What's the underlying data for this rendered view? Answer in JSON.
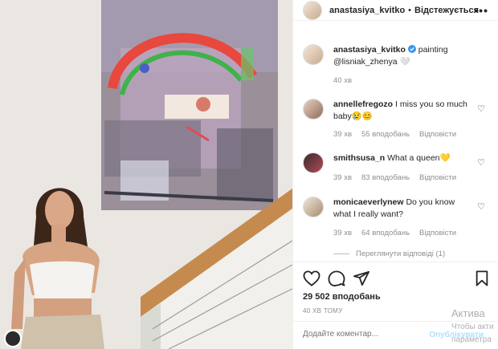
{
  "post": {
    "username": "anastasiya_kvitko",
    "follow_label": "Відстежується",
    "separator": "•",
    "more_label": "•••",
    "caption_text": "painting",
    "caption_mention": "@lisniak_zhenya",
    "caption_emoji": "🤍",
    "caption_time": "40 хв"
  },
  "comments": [
    {
      "user": "annellefregozo",
      "text": "I miss you so much baby😢😊",
      "time": "39 хв",
      "likes": "55 вподобань",
      "reply": "Відповісти"
    },
    {
      "user": "smithsusa_n",
      "text": "What a queen💛",
      "time": "39 хв",
      "likes": "83 вподобань",
      "reply": "Відповісти"
    },
    {
      "user": "monicaeverlynew",
      "text": "Do you know what I really want?",
      "time": "39 хв",
      "likes": "64 вподобань",
      "reply": "Відповісти"
    }
  ],
  "view_replies": "Переглянути відповіді (1)",
  "likes_count": "29 502 вподобань",
  "post_time": "40 ХВ ТОМУ",
  "add_comment_placeholder": "Додайте коментар...",
  "publish_label": "Опублікувати",
  "windows_activation": {
    "line1": "Актива",
    "line2": "Чтобы акти",
    "line3": "параметра"
  },
  "colors": {
    "accent": "#0095f6",
    "verified": "#3897f0",
    "muted": "#8e8e8e",
    "publish_disabled": "#b2dffc"
  },
  "icons": [
    "heart-icon",
    "comment-icon",
    "share-icon",
    "bookmark-icon",
    "verified-icon",
    "more-icon"
  ]
}
